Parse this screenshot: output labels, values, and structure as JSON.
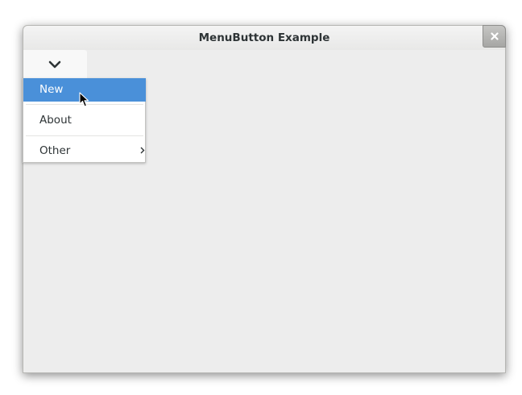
{
  "window": {
    "title": "MenuButton Example",
    "close_icon": "close-icon",
    "menu_button_icon": "chevron-down-icon"
  },
  "menu": {
    "items": [
      {
        "label": "New",
        "highlighted": true
      },
      {
        "label": "About",
        "highlighted": false
      },
      {
        "label": "Other",
        "highlighted": false,
        "submenu_icon": "chevron-right-icon"
      }
    ]
  },
  "colors": {
    "highlight": "#4a90d9",
    "window_bg": "#ededed",
    "text": "#2e3436"
  }
}
